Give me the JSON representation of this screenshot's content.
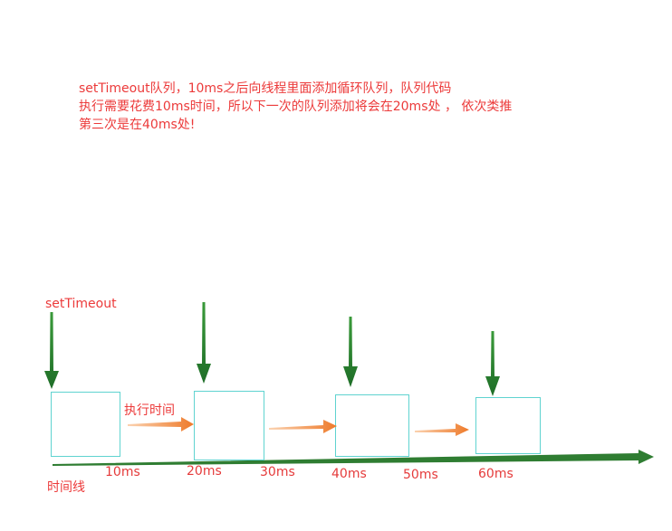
{
  "description": {
    "lines": [
      "setTimeout队列，10ms之后向线程里面添加循环队列，队列代码",
      "执行需要花费10ms时间，所以下一次的队列添加将会在20ms处 ， 依次类推",
      "第三次是在40ms处!"
    ]
  },
  "labels": {
    "set_timeout": "setTimeout",
    "execute_time": "执行时间",
    "timeline": "时间线"
  },
  "ticks": [
    "10ms",
    "20ms",
    "30ms",
    "40ms",
    "50ms",
    "60ms"
  ],
  "colors": {
    "text_red": "#ec3a3a",
    "box_border": "#4fd0d0",
    "green_arrow": "#2e7d32",
    "orange_arrow": "#f08a3c"
  }
}
